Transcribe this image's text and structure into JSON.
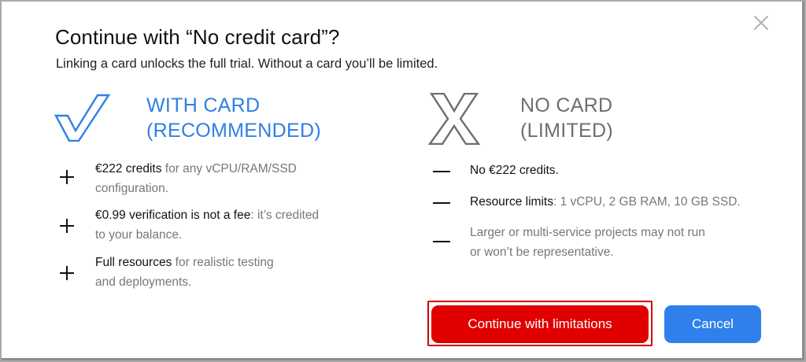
{
  "dialog": {
    "title": "Continue with “No credit card”?",
    "subtitle": "Linking a card unlocks the full trial. Without a card you’ll be limited."
  },
  "with_card": {
    "heading_line1": "WITH CARD",
    "heading_line2": "(RECOMMENDED)",
    "icon": "checkmark-icon",
    "items": [
      {
        "bold": "€222 credits",
        "line1_rest": " for any vCPU/RAM/SSD",
        "line2": "configuration."
      },
      {
        "bold": "€0.99 verification is not a fee",
        "line1_rest": ": it’s credited",
        "line2": "to your balance."
      },
      {
        "bold": "Full resources",
        "line1_rest": " for realistic testing",
        "line2": "and deployments."
      }
    ]
  },
  "no_card": {
    "heading_line1": "NO CARD",
    "heading_line2": "(LIMITED)",
    "icon": "x-mark-icon",
    "items": [
      {
        "bold": "No €222 credits.",
        "line1_rest": "",
        "line2": ""
      },
      {
        "bold": "Resource limits",
        "line1_rest": ": 1 vCPU, 2 GB RAM, 10 GB SSD.",
        "line2": ""
      },
      {
        "bold": "",
        "line1_rest": "Larger or multi-service projects may not run",
        "line2": "or won’t be representative."
      }
    ]
  },
  "buttons": {
    "continue_label": "Continue with limitations",
    "cancel_label": "Cancel"
  },
  "colors": {
    "accent_blue": "#2f7fe6",
    "danger_red": "#e00000",
    "muted_gray": "#6e6e6e"
  }
}
